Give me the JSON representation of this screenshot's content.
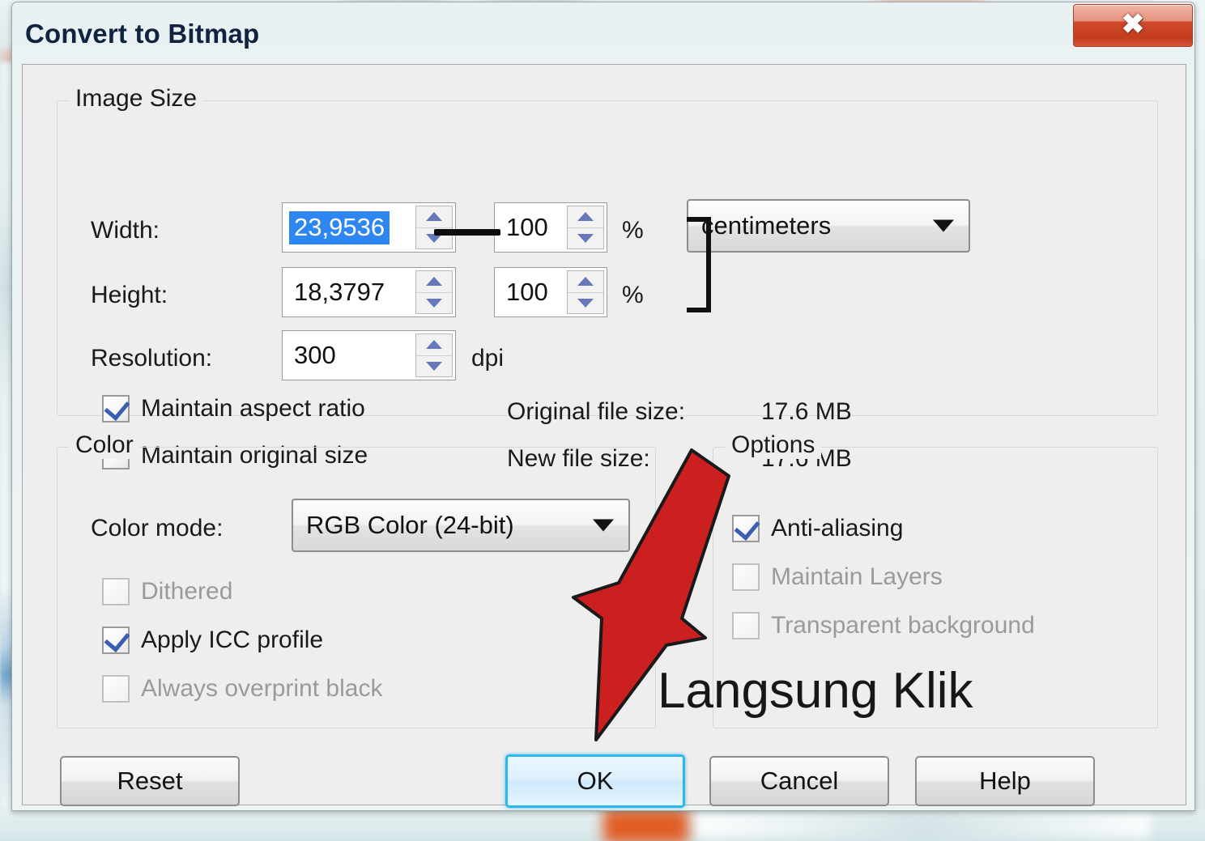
{
  "window": {
    "title": "Convert to Bitmap",
    "close_label": "✕",
    "close_icon": "close-icon"
  },
  "image_size": {
    "legend": "Image Size",
    "width_label": "Width:",
    "width_value": "23,9536",
    "width_percent": "100",
    "height_label": "Height:",
    "height_value": "18,3797",
    "height_percent": "100",
    "percent_symbol": "%",
    "units_value": "centimeters",
    "resolution_label": "Resolution:",
    "resolution_value": "300",
    "resolution_unit": "dpi",
    "maintain_aspect_ratio": {
      "label": "Maintain aspect ratio",
      "checked": true,
      "enabled": true
    },
    "maintain_original_size": {
      "label": "Maintain original size",
      "checked": false,
      "enabled": true
    },
    "original_file_size_label": "Original file size:",
    "original_file_size_value": "17.6 MB",
    "new_file_size_label": "New file size:",
    "new_file_size_value": "17.6 MB"
  },
  "color": {
    "legend": "Color",
    "mode_label": "Color mode:",
    "mode_value": "RGB Color (24-bit)",
    "dithered": {
      "label": "Dithered",
      "checked": false,
      "enabled": false
    },
    "apply_icc_profile": {
      "label": "Apply ICC profile",
      "checked": true,
      "enabled": true
    },
    "always_overprint_black": {
      "label": "Always overprint black",
      "checked": false,
      "enabled": false
    }
  },
  "options": {
    "legend": "Options",
    "anti_aliasing": {
      "label": "Anti-aliasing",
      "checked": true,
      "enabled": true
    },
    "maintain_layers": {
      "label": "Maintain Layers",
      "checked": false,
      "enabled": false
    },
    "transparent_background": {
      "label": "Transparent background",
      "checked": false,
      "enabled": false
    }
  },
  "buttons": {
    "reset": "Reset",
    "ok": "OK",
    "cancel": "Cancel",
    "help": "Help"
  },
  "annotation": {
    "text": "Langsung Klik",
    "arrow_color": "#CC2020",
    "arrow_outline": "#1a1a1a",
    "arrow_icon": "down-left-arrow-icon"
  },
  "colors": {
    "dialog_bg": "#eeeeee",
    "selection_blue": "#2e86f0",
    "primary_glow": "#2bb6ec",
    "close_red": "#c43c1e",
    "check_blue": "#3a5fb0"
  }
}
